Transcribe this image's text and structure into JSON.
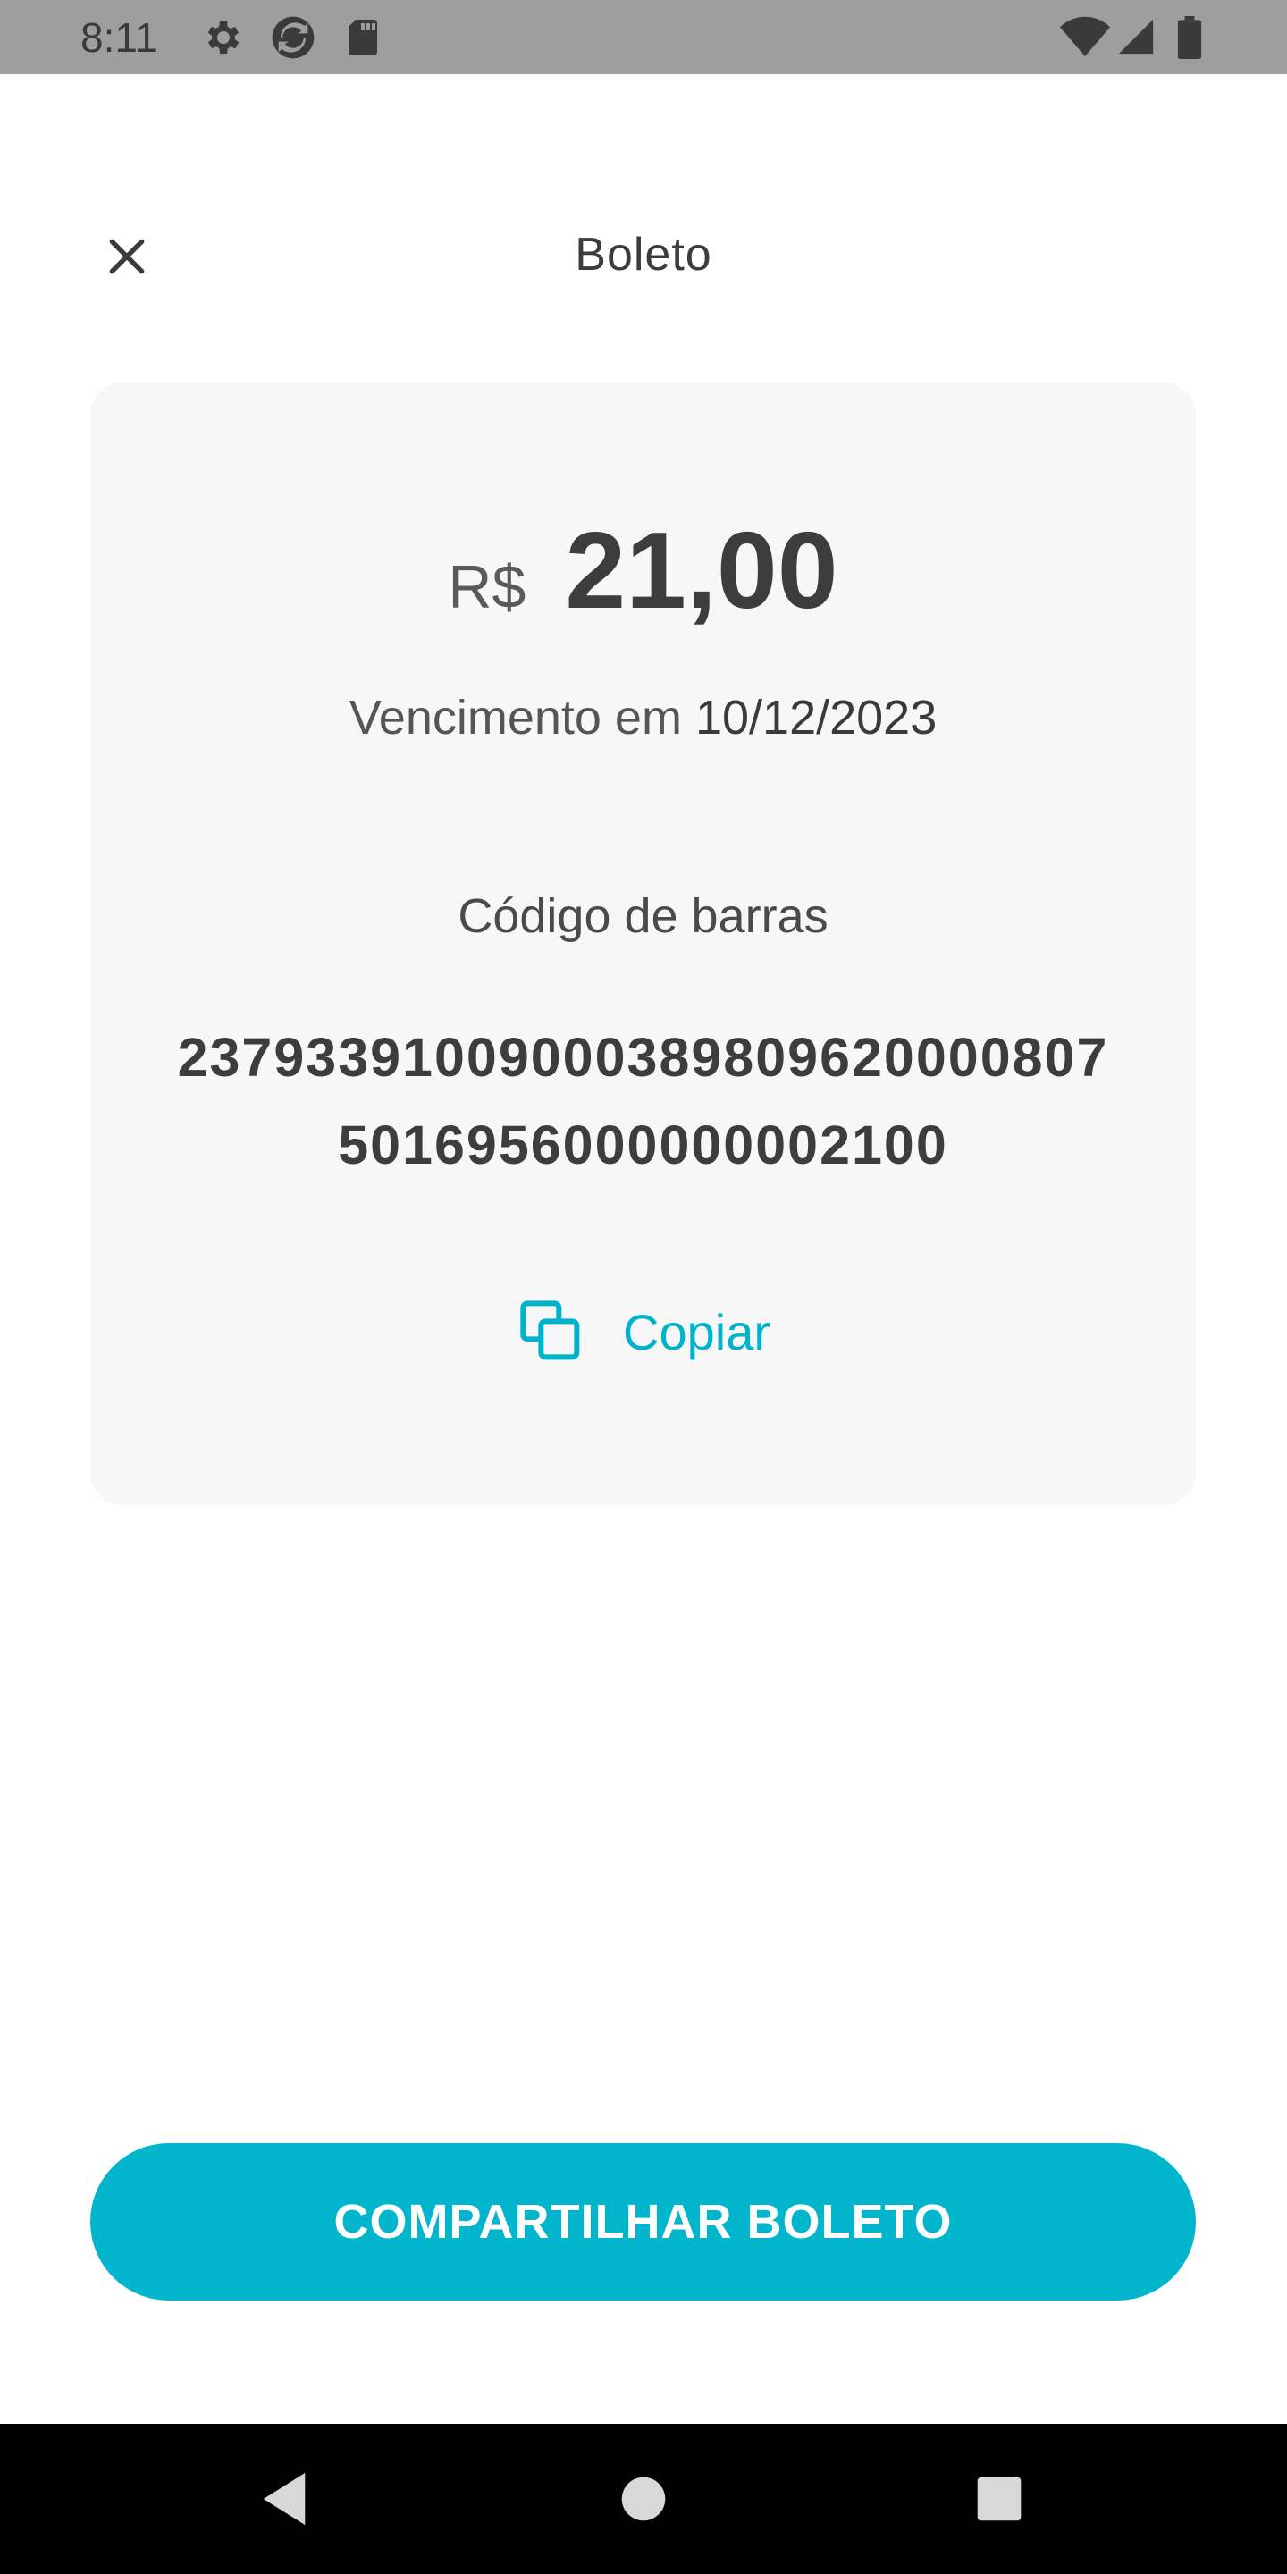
{
  "status_bar": {
    "time": "8:11",
    "icons": [
      "gear-icon",
      "sync-icon",
      "sd-card-icon",
      "wifi-icon",
      "signal-icon",
      "battery-icon"
    ]
  },
  "header": {
    "title": "Boleto",
    "close_icon": "close-icon"
  },
  "boleto": {
    "currency": "R$",
    "amount": "21,00",
    "due_prefix": "Vencimento em",
    "due_date": "10/12/2023",
    "barcode_label": "Código de barras",
    "barcode_line1": "23793391009000389809620000807",
    "barcode_line2": "5016956000000002100",
    "copy_label": "Copiar"
  },
  "actions": {
    "share_label": "COMPARTILHAR BOLETO"
  },
  "nav": {
    "icons": [
      "back-icon",
      "home-icon",
      "recents-icon"
    ]
  },
  "colors": {
    "accent": "#00b5cc",
    "status_bar": "#9e9e9e",
    "card_bg": "#f7f7f7",
    "text_dark": "#3d3d3d"
  }
}
